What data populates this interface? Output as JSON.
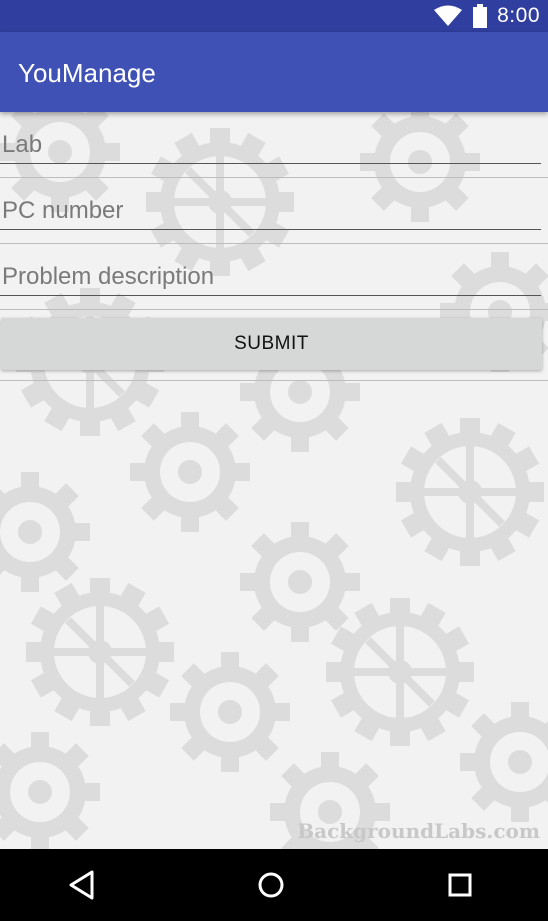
{
  "status_bar": {
    "time": "8:00",
    "icons": [
      "wifi-icon",
      "battery-icon"
    ]
  },
  "app_bar": {
    "title": "YouManage",
    "color": "#3f51b5",
    "status_color": "#303f9f"
  },
  "form": {
    "lab_placeholder": "Lab",
    "pc_number_placeholder": "PC number",
    "problem_placeholder": "Problem description",
    "submit_label": "SUBMIT"
  },
  "watermark": "BackgroundLabs.com",
  "nav": {
    "icons": [
      "back-icon",
      "home-icon",
      "recents-icon"
    ]
  }
}
